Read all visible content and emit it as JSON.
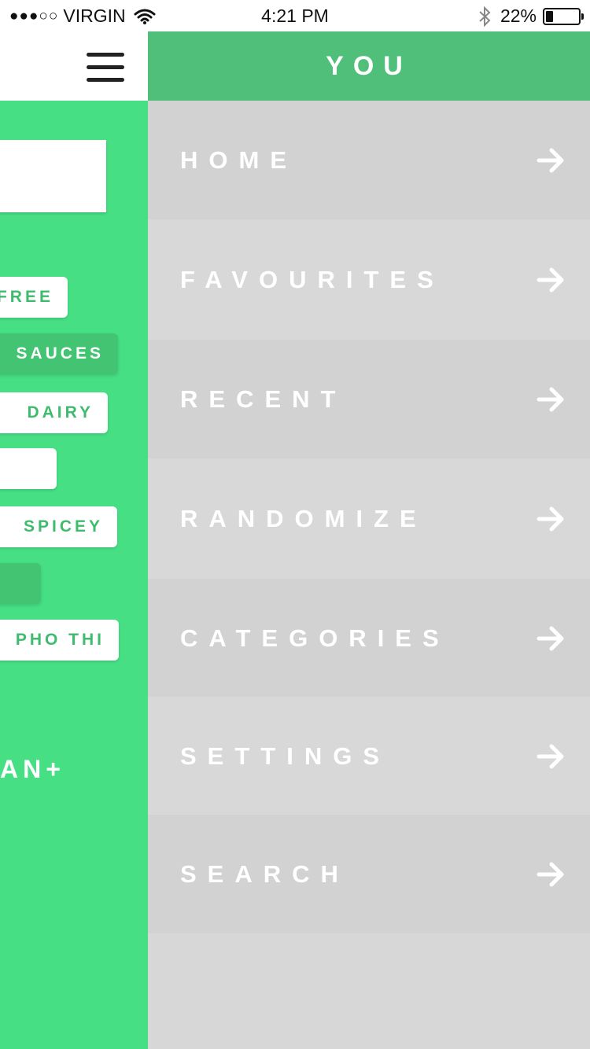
{
  "status_bar": {
    "signal": "●●●○○",
    "carrier": "VIRGIN",
    "time": "4:21 PM",
    "battery": "22%"
  },
  "left": {
    "tags": [
      "FREE",
      "SAUCES",
      "DAIRY",
      "",
      "SPICEY",
      "",
      "PHO THI"
    ],
    "plan_label": "AN+"
  },
  "drawer": {
    "title": "YOU",
    "items": [
      {
        "label": "HOME"
      },
      {
        "label": "FAVOURITES"
      },
      {
        "label": "RECENT"
      },
      {
        "label": "RANDOMIZE"
      },
      {
        "label": "CATEGORIES"
      },
      {
        "label": "SETTINGS"
      },
      {
        "label": "SEARCH"
      }
    ]
  },
  "colors": {
    "green": "#46df84",
    "header_green": "#4fbf79",
    "menu_gray": "#d7d7d7"
  },
  "icons": {
    "menu": "hamburger-icon",
    "arrow": "arrow-right-icon",
    "wifi": "wifi-icon",
    "bluetooth": "bluetooth-icon",
    "battery": "battery-icon"
  }
}
